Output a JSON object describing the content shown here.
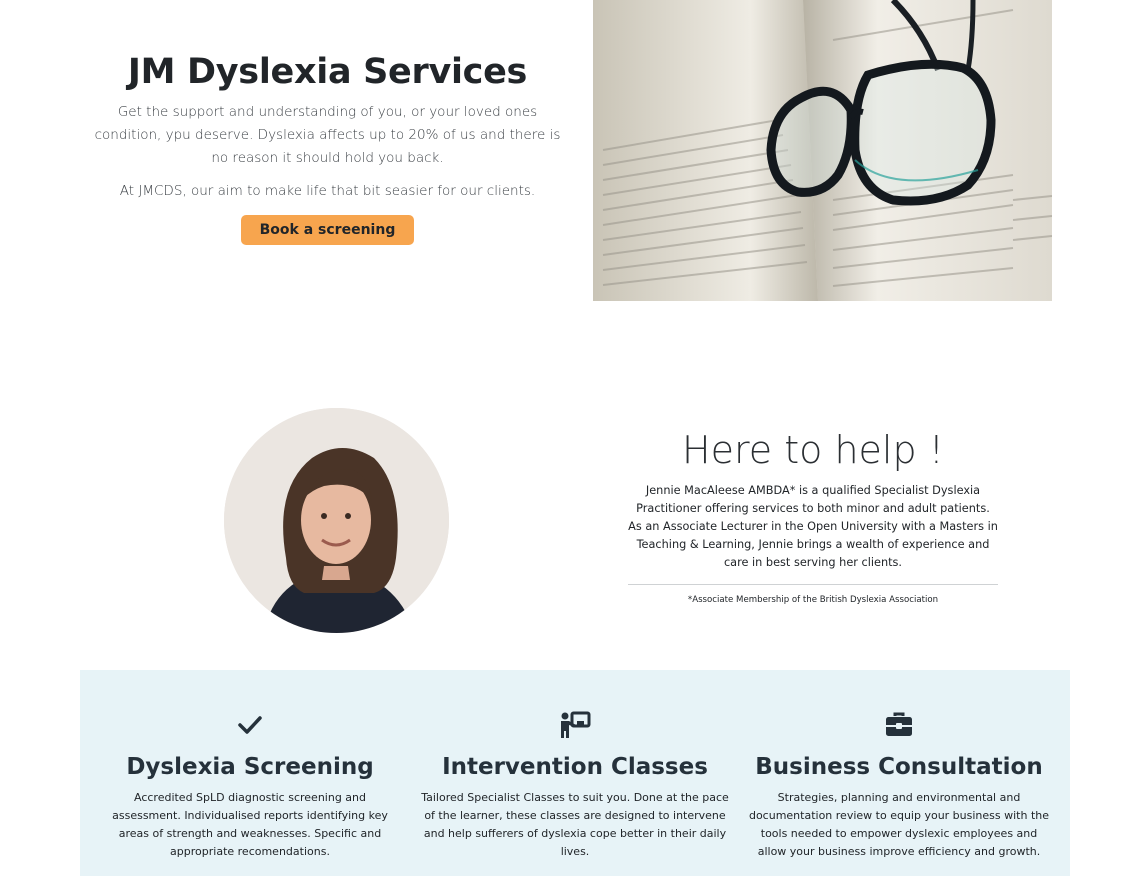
{
  "hero": {
    "title": "JM Dyslexia Services",
    "paragraph1": "Get the support and understanding of you, or your loved ones condition, ypu deserve. Dyslexia affects up to 20% of us and there is no reason it should hold you back.",
    "paragraph2": "At JMCDS, our aim to make life that bit seasier for our clients.",
    "button_label": "Book a screening"
  },
  "about": {
    "title": "Here to help !",
    "bio": "Jennie MacAleese AMBDA* is a qualified Specialist Dyslexia Practitioner offering services to both minor and adult patients. As an Associate Lecturer in the Open University with a Masters in Teaching & Learning, Jennie brings a wealth of experience and care in best serving her clients.",
    "footnote": "*Associate Membership of the British Dyslexia Association"
  },
  "services": [
    {
      "icon": "check-icon",
      "title": "Dyslexia Screening",
      "description": "Accredited SpLD diagnostic screening and assessment. Individualised reports identifying key areas of strength and weaknesses. Specific and appropriate recomendations."
    },
    {
      "icon": "teacher-board-icon",
      "title": "Intervention Classes",
      "description": "Tailored Specialist Classes to suit you. Done at the pace of the learner, these classes are designed to intervene and help sufferers of dyslexia cope better in their daily lives."
    },
    {
      "icon": "briefcase-icon",
      "title": "Business Consultation",
      "description": "Strategies, planning and environmental and documentation review to equip your business with the tools needed to empower dyslexic employees and allow your business improve efficiency and growth."
    }
  ],
  "colors": {
    "button": "#f7a54e",
    "services_background": "#e7f3f7",
    "heading": "#212529"
  }
}
